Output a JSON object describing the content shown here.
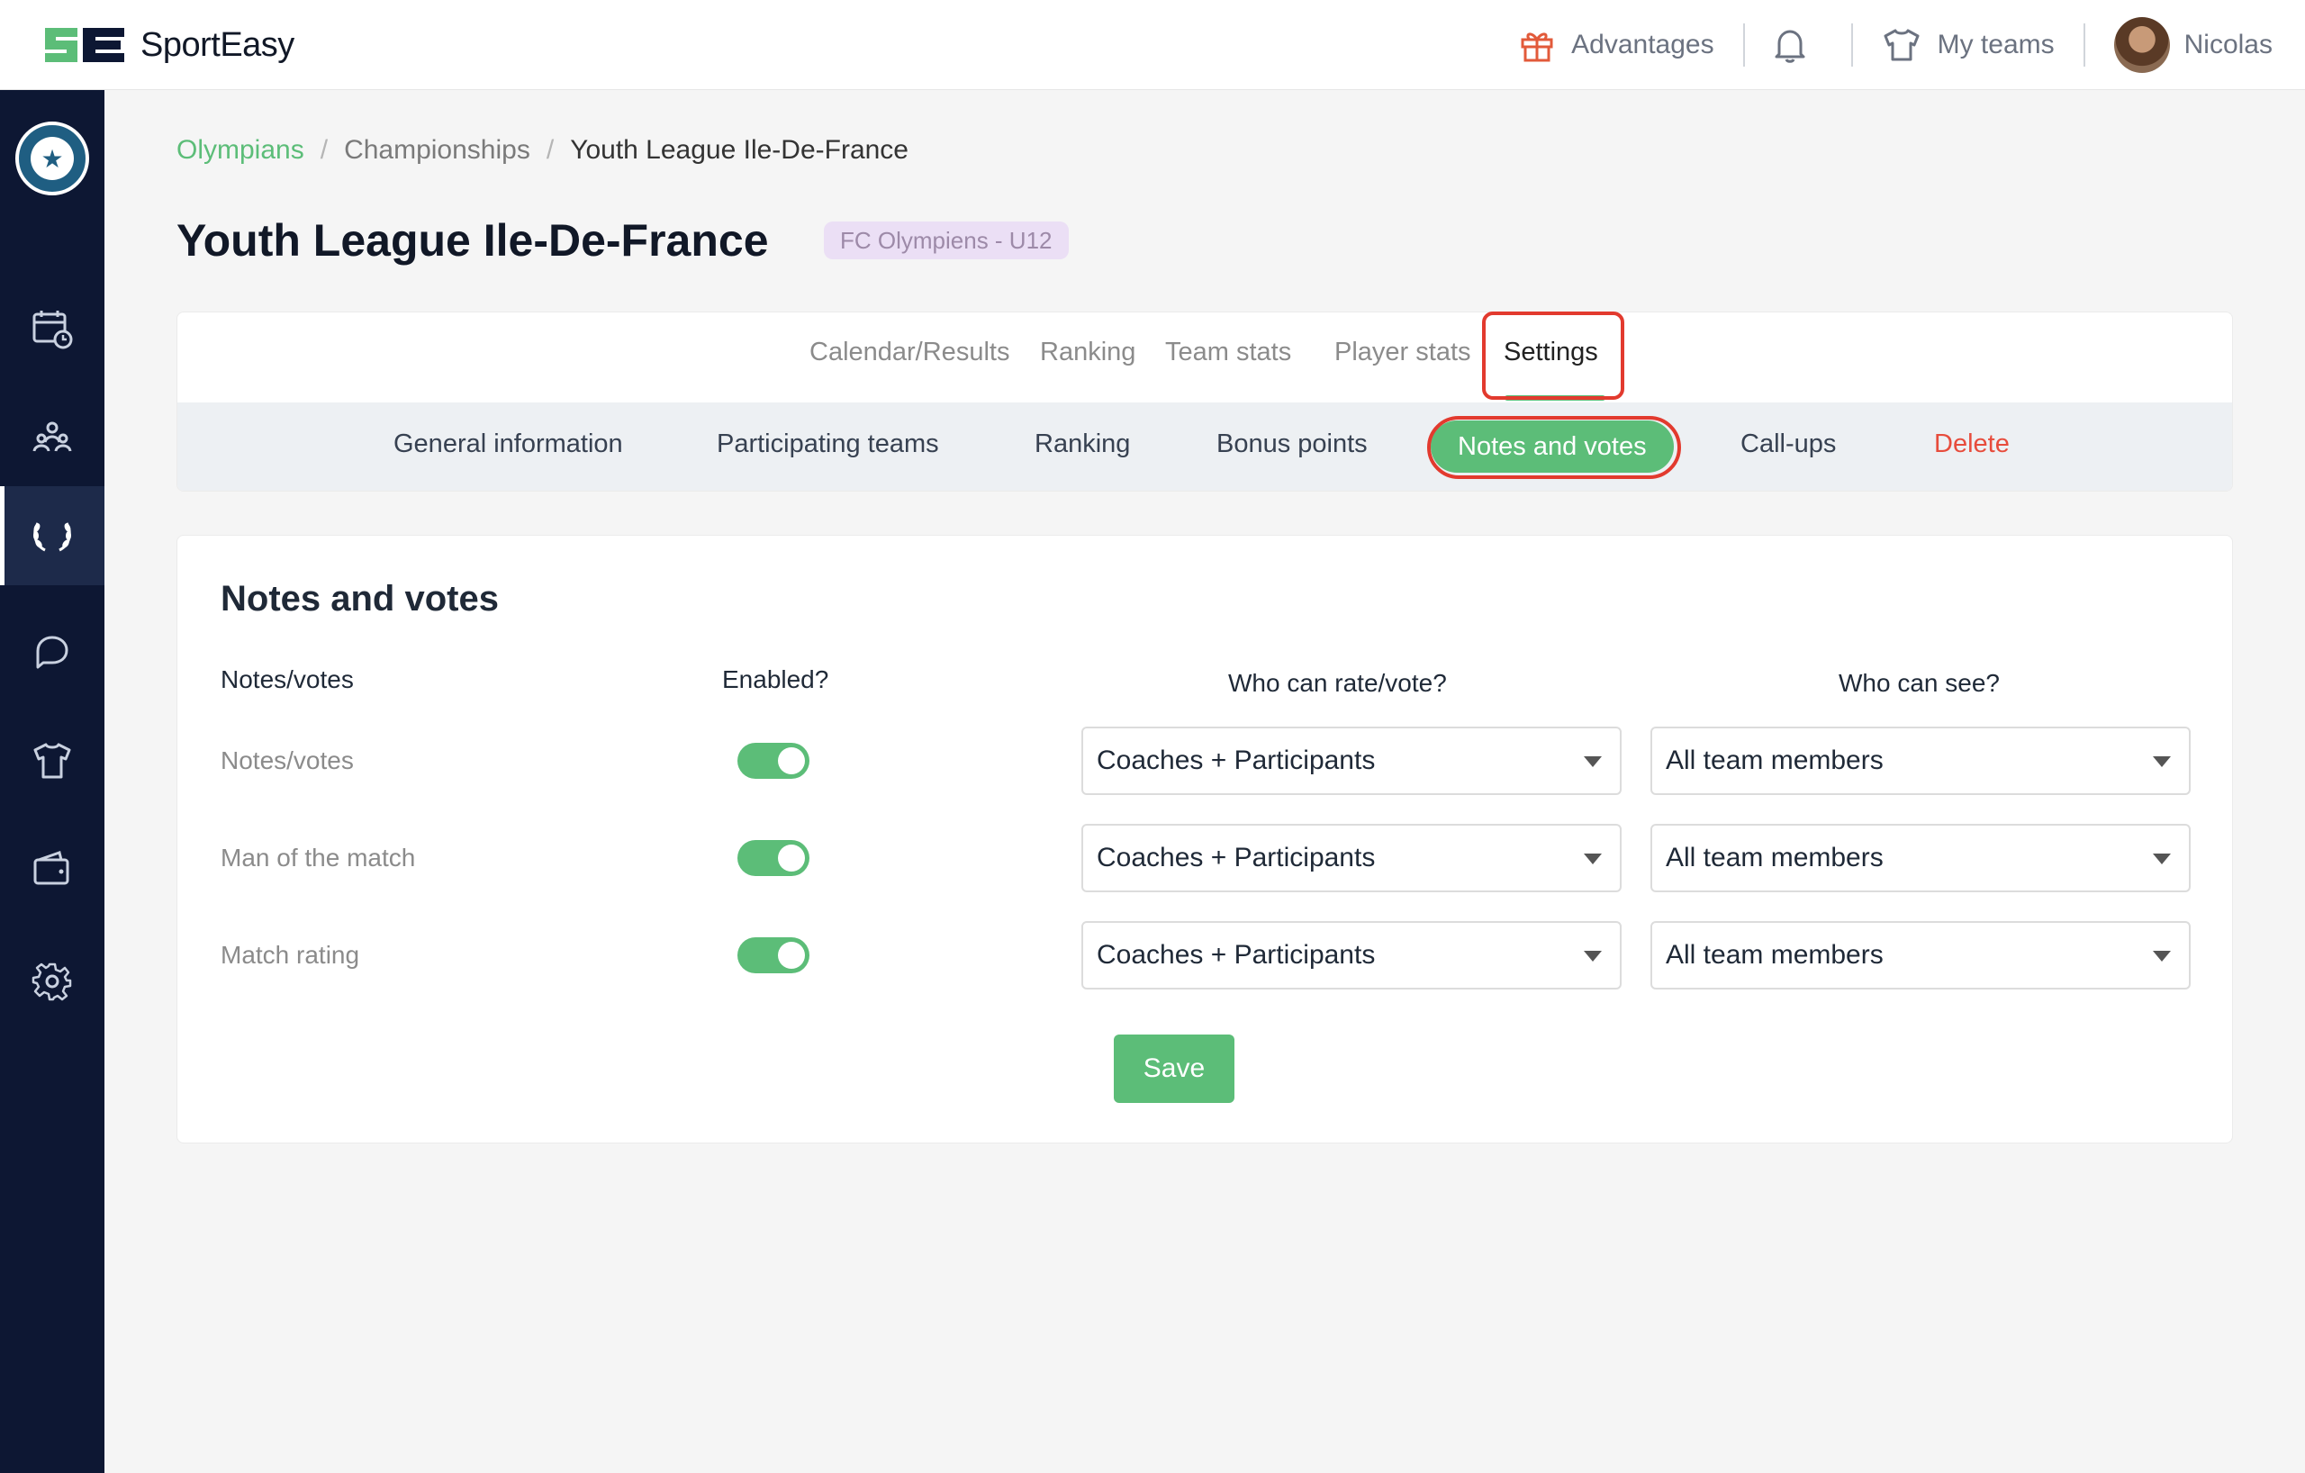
{
  "app": {
    "name": "SportEasy"
  },
  "topnav": {
    "advantages": "Advantages",
    "my_teams": "My teams",
    "user": "Nicolas"
  },
  "breadcrumb": [
    "Olympians",
    "Championships",
    "Youth League Ile-De-France"
  ],
  "page": {
    "title": "Youth League Ile-De-France",
    "badge": "FC Olympiens - U12"
  },
  "tabs": [
    {
      "label": "Calendar/Results",
      "active": false
    },
    {
      "label": "Ranking",
      "active": false
    },
    {
      "label": "Team stats",
      "active": false
    },
    {
      "label": "Player stats",
      "active": false
    },
    {
      "label": "Settings",
      "active": true
    }
  ],
  "subtabs": [
    {
      "label": "General information",
      "active": false
    },
    {
      "label": "Participating teams",
      "active": false
    },
    {
      "label": "Ranking",
      "active": false
    },
    {
      "label": "Bonus points",
      "active": false
    },
    {
      "label": "Notes and votes",
      "active": true
    },
    {
      "label": "Call-ups",
      "active": false
    },
    {
      "label": "Delete",
      "active": false,
      "danger": true
    }
  ],
  "notes_card": {
    "title": "Notes and votes",
    "headers": {
      "type": "Notes/votes",
      "enabled": "Enabled?",
      "who_rate": "Who can rate/vote?",
      "who_see": "Who can see?"
    },
    "rows": [
      {
        "label": "Notes/votes",
        "enabled": true,
        "who_rate": "Coaches + Participants",
        "who_see": "All team members"
      },
      {
        "label": "Man of the match",
        "enabled": true,
        "who_rate": "Coaches + Participants",
        "who_see": "All team members"
      },
      {
        "label": "Match rating",
        "enabled": true,
        "who_rate": "Coaches + Participants",
        "who_see": "All team members"
      }
    ],
    "save_label": "Save"
  },
  "sidebar_icons": [
    "calendar-icon",
    "members-icon",
    "championship-icon",
    "chat-icon",
    "jersey-icon",
    "wallet-icon",
    "settings-icon"
  ],
  "colors": {
    "accent": "#5cbd78",
    "sidebar_bg": "#0d1733",
    "danger": "#e74c3c",
    "highlight_box": "#e23a2e",
    "badge_bg": "#ebdff5"
  }
}
